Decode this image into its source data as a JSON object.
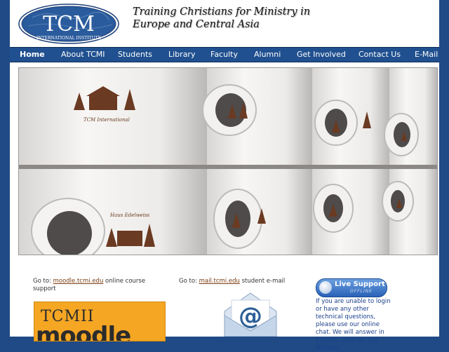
{
  "header": {
    "logo_text": "TCM",
    "logo_subtext": "INTERNATIONAL INSTITUTE",
    "tagline_line1": "Training Christians for Ministry in",
    "tagline_line2": "Europe and Central Asia"
  },
  "nav": {
    "items": [
      {
        "label": "Home"
      },
      {
        "label": "About TCMI"
      },
      {
        "label": "Students"
      },
      {
        "label": "Library"
      },
      {
        "label": "Faculty"
      },
      {
        "label": "Alumni"
      },
      {
        "label": "Get Involved"
      },
      {
        "label": "Contact Us"
      },
      {
        "label": "E-Mail"
      }
    ]
  },
  "hero": {
    "image_icon": "coffee-mugs-photo",
    "mug_print_text": "TCM International",
    "mug_print_text2": "Haus Edelweiss"
  },
  "moodle": {
    "prefix": "Go to: ",
    "link_text": "moodle.tcmi.edu",
    "suffix": " online course support",
    "banner_title": "TCMII",
    "banner_word": "moodle"
  },
  "mail": {
    "prefix": "Go to: ",
    "link_text": "mail.tcmi.edu",
    "suffix": " student e-mail",
    "icon": "envelope-at-icon"
  },
  "live_support": {
    "label": "Live Support",
    "status": "OFFLINE",
    "text": "If you are unable to login or have any other technical questions, please use our online chat. We will answer in English, German and Russian."
  },
  "colors": {
    "background": "#1f4a86",
    "nav": "#20508f",
    "link": "#7a3c10",
    "support_text": "#1b3f8a"
  }
}
